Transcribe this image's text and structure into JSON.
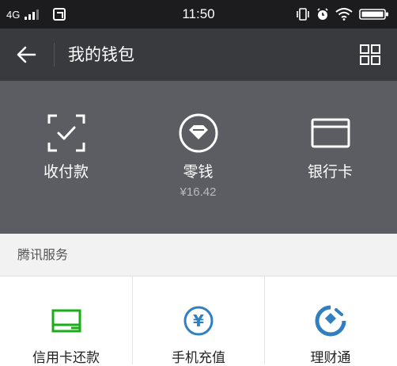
{
  "status_bar": {
    "network": "4G",
    "time": "11:50",
    "icons": [
      "signal-icon",
      "app-notification-icon",
      "vibrate-icon",
      "alarm-icon",
      "wifi-icon",
      "battery-icon"
    ]
  },
  "header": {
    "title": "我的钱包",
    "back_icon": "back-arrow-icon",
    "menu_icon": "grid-menu-icon"
  },
  "wallet": {
    "items": [
      {
        "label": "收付款",
        "icon": "scan-pay-icon"
      },
      {
        "label": "零钱",
        "value": "¥16.42",
        "icon": "change-icon"
      },
      {
        "label": "银行卡",
        "icon": "bank-card-icon"
      }
    ]
  },
  "services_section": {
    "title": "腾讯服务",
    "items": [
      {
        "label": "信用卡还款",
        "icon": "credit-card-icon",
        "color": "#1aad19"
      },
      {
        "label": "手机充值",
        "icon": "yuan-coin-icon",
        "color": "#2f7fc1"
      },
      {
        "label": "理财通",
        "icon": "wealth-icon",
        "color": "#2f7fc1"
      }
    ]
  },
  "colors": {
    "status_bar": "#1c1c1e",
    "nav_bar": "#393a3e",
    "wallet_panel": "#5b5d63",
    "section_bg": "#f2f2f2"
  }
}
